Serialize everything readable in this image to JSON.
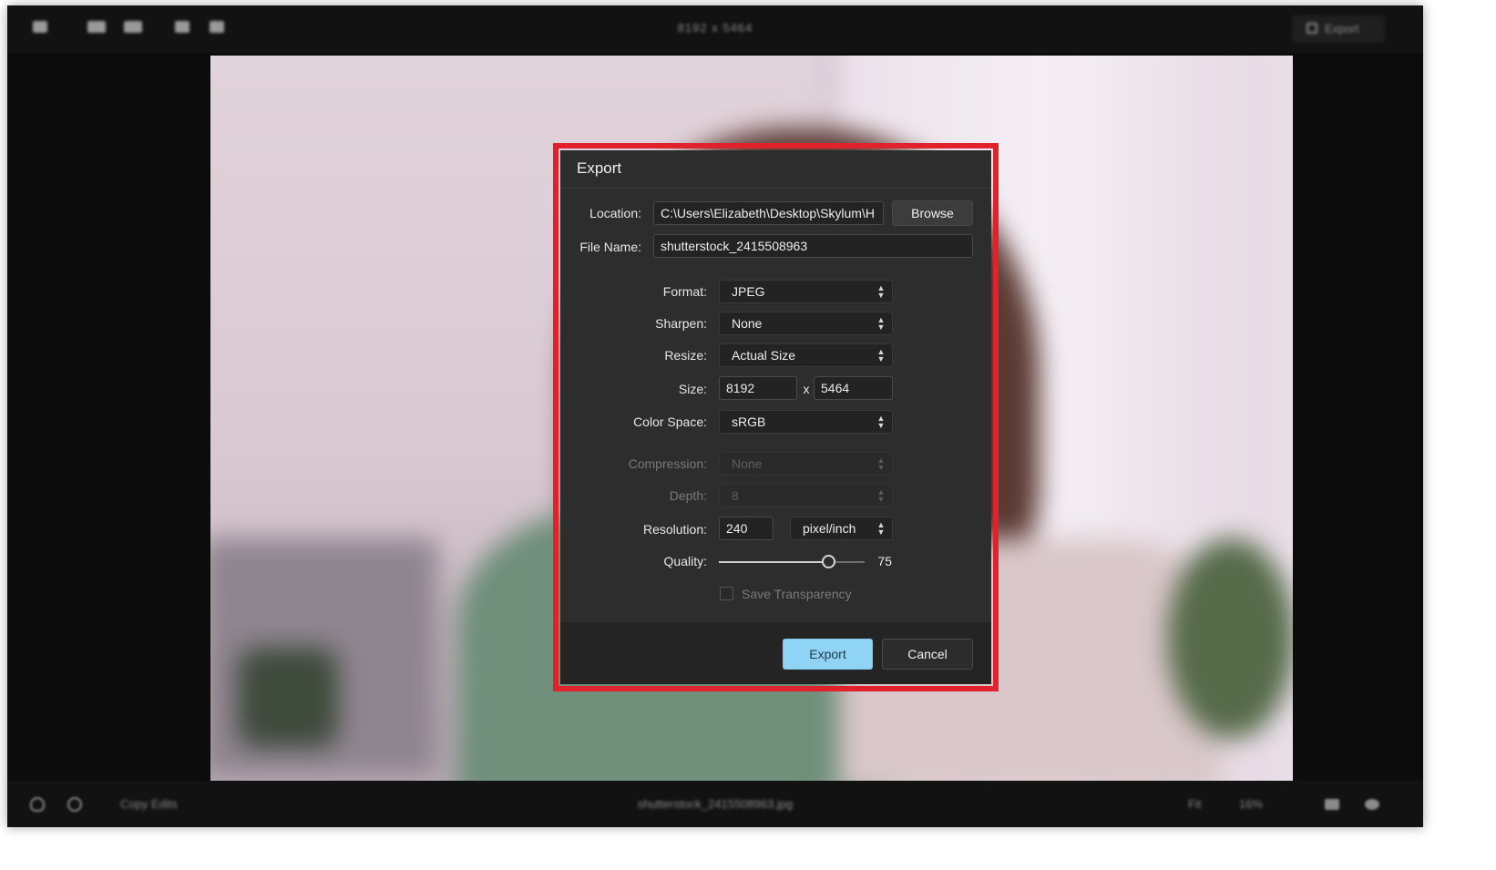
{
  "topbar": {
    "title": "8192 x 5464",
    "export_label": "Export"
  },
  "bottombar": {
    "copy_edits_label": "Copy Edits",
    "filename": "shutterstock_2415508963.jpg",
    "fit_label": "Fit",
    "zoom_label": "16%"
  },
  "dialog": {
    "title": "Export",
    "location": {
      "label": "Location:",
      "value": "C:\\Users\\Elizabeth\\Desktop\\Skylum\\H",
      "browse_label": "Browse"
    },
    "file_name": {
      "label": "File Name:",
      "value": "shutterstock_2415508963"
    },
    "format": {
      "label": "Format:",
      "value": "JPEG"
    },
    "sharpen": {
      "label": "Sharpen:",
      "value": "None"
    },
    "resize": {
      "label": "Resize:",
      "value": "Actual Size"
    },
    "size": {
      "label": "Size:",
      "width": "8192",
      "separator": "x",
      "height": "5464"
    },
    "color_space": {
      "label": "Color Space:",
      "value": "sRGB"
    },
    "compression": {
      "label": "Compression:",
      "value": "None"
    },
    "depth": {
      "label": "Depth:",
      "value": "8"
    },
    "resolution": {
      "label": "Resolution:",
      "value": "240",
      "unit": "pixel/inch"
    },
    "quality": {
      "label": "Quality:",
      "value": "75",
      "fraction": 0.75
    },
    "save_transparency": {
      "label": "Save Transparency",
      "checked": false
    },
    "export_label": "Export",
    "cancel_label": "Cancel"
  },
  "colors": {
    "highlight": "#e0222d",
    "primary_button": "#8fd3f5",
    "dialog_bg": "#2d2d2d"
  }
}
